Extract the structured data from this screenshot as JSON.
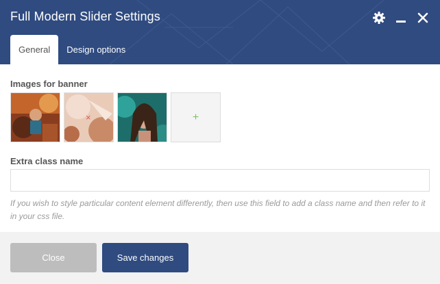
{
  "window": {
    "title": "Full Modern Slider Settings"
  },
  "header_icons": [
    {
      "name": "gear-icon"
    },
    {
      "name": "minimize-icon"
    },
    {
      "name": "close-icon"
    }
  ],
  "tabs": [
    {
      "label": "General",
      "active": true
    },
    {
      "label": "Design options",
      "active": false
    }
  ],
  "images_section": {
    "label": "Images for banner",
    "thumbnails": [
      {
        "name": "banner-image-1"
      },
      {
        "name": "banner-image-2",
        "remove_icon": "×"
      },
      {
        "name": "banner-image-3"
      }
    ],
    "add_symbol": "+"
  },
  "extra_class": {
    "label": "Extra class name",
    "value": "",
    "help": "If you wish to style particular content element differently, then use this field to add a class name and then refer to it in your css file."
  },
  "footer": {
    "close_label": "Close",
    "save_label": "Save changes"
  },
  "colors": {
    "header": "#2f4b80",
    "primary_button": "#2f4b80",
    "close_button": "#bdbdbd",
    "add_plus": "#7cc36b"
  }
}
